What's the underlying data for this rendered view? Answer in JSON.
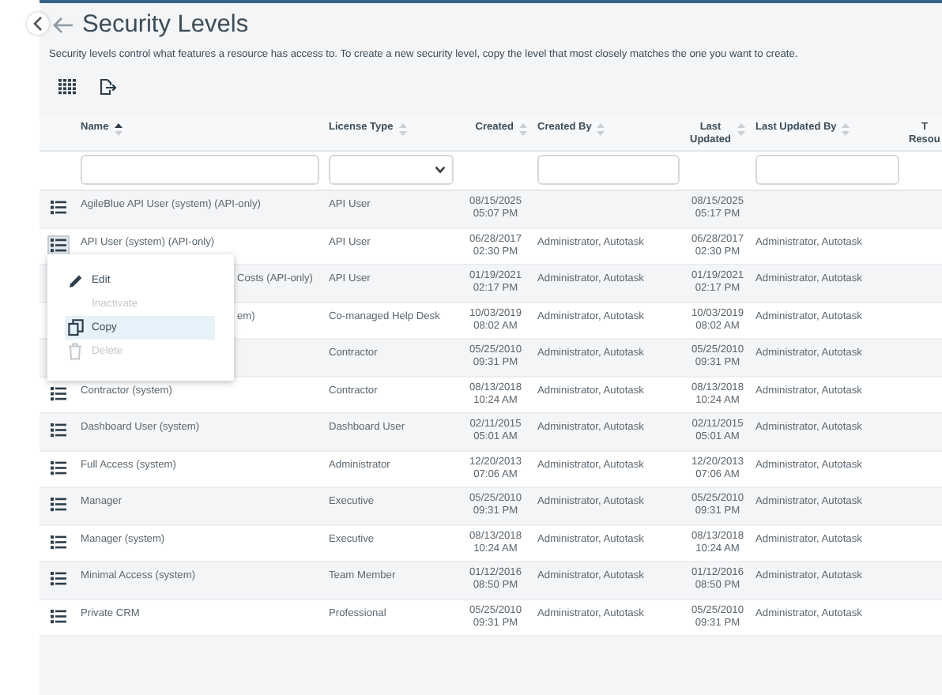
{
  "page": {
    "title": "Security Levels",
    "description": "Security levels control what features a resource has access to. To create a new security level, copy the level that most closely matches the one you want to create."
  },
  "table": {
    "columns": [
      {
        "label": "Name",
        "sorted": true,
        "kind": "text"
      },
      {
        "label": "License Type",
        "sorted": false,
        "kind": "select"
      },
      {
        "label": "Created",
        "sorted": false,
        "kind": "plain"
      },
      {
        "label": "Created By",
        "sorted": false,
        "kind": "text"
      },
      {
        "label": "Last Updated",
        "sorted": false,
        "kind": "plain"
      },
      {
        "label": "Last Updated By",
        "sorted": false,
        "kind": "text"
      },
      {
        "label": "T Resou",
        "kind": "plain"
      }
    ],
    "rows": [
      {
        "name": "AgileBlue API User (system) (API-only)",
        "license_type": "API User",
        "created": "08/15/2025 05:07 PM",
        "last_updated": "08/15/2025 05:17 PM",
        "menu_open": false
      },
      {
        "name": "API User (system) (API-only)",
        "license_type": "API User",
        "created": "06/28/2017 02:30 PM",
        "created_by": "Administrator, Autotask",
        "last_updated": "06/28/2017 02:30 PM",
        "last_updated_by": "Administrator, Autotask",
        "menu_open": true
      },
      {
        "name": "Costs (API-only)",
        "license_type": "API User",
        "created": "01/19/2021 02:17 PM",
        "created_by": "Administrator, Autotask",
        "last_updated": "01/19/2021 02:17 PM",
        "last_updated_by": "Administrator, Autotask",
        "covered": true
      },
      {
        "name": "em)",
        "license_type": "Co-managed Help Desk",
        "created": "10/03/2019 08:02 AM",
        "created_by": "Administrator, Autotask",
        "last_updated": "10/03/2019 08:02 AM",
        "last_updated_by": "Administrator, Autotask",
        "covered": true
      },
      {
        "license_type": "Contractor",
        "created": "05/25/2010 09:31 PM",
        "created_by": "Administrator, Autotask",
        "last_updated": "05/25/2010 09:31 PM",
        "last_updated_by": "Administrator, Autotask"
      },
      {
        "name": "Contractor (system)",
        "license_type": "Contractor",
        "created": "08/13/2018 10:24 AM",
        "created_by": "Administrator, Autotask",
        "last_updated": "08/13/2018 10:24 AM",
        "last_updated_by": "Administrator, Autotask",
        "menu_open": false
      },
      {
        "name": "Dashboard User (system)",
        "license_type": "Dashboard User",
        "created": "02/11/2015 05:01 AM",
        "created_by": "Administrator, Autotask",
        "last_updated": "02/11/2015 05:01 AM",
        "last_updated_by": "Administrator, Autotask",
        "menu_open": false
      },
      {
        "name": "Full Access (system)",
        "license_type": "Administrator",
        "created": "12/20/2013 07:06 AM",
        "created_by": "Administrator, Autotask",
        "last_updated": "12/20/2013 07:06 AM",
        "last_updated_by": "Administrator, Autotask",
        "menu_open": false
      },
      {
        "name": "Manager",
        "license_type": "Executive",
        "created": "05/25/2010 09:31 PM",
        "created_by": "Administrator, Autotask",
        "last_updated": "05/25/2010 09:31 PM",
        "last_updated_by": "Administrator, Autotask",
        "menu_open": false
      },
      {
        "name": "Manager (system)",
        "license_type": "Executive",
        "created": "08/13/2018 10:24 AM",
        "created_by": "Administrator, Autotask",
        "last_updated": "08/13/2018 10:24 AM",
        "last_updated_by": "Administrator, Autotask",
        "menu_open": false
      },
      {
        "name": "Minimal Access (system)",
        "license_type": "Team Member",
        "created": "01/12/2016 08:50 PM",
        "created_by": "Administrator, Autotask",
        "last_updated": "01/12/2016 08:50 PM",
        "last_updated_by": "Administrator, Autotask",
        "menu_open": false
      },
      {
        "name": "Private CRM",
        "license_type": "Professional",
        "created": "05/25/2010 09:31 PM",
        "created_by": "Administrator, Autotask",
        "last_updated": "05/25/2010 09:31 PM",
        "last_updated_by": "Administrator, Autotask",
        "menu_open": false
      }
    ]
  },
  "context_menu": {
    "items": [
      {
        "label": "Edit",
        "disabled": false,
        "selected": false
      },
      {
        "label": "Inactivate",
        "disabled": true,
        "selected": false
      },
      {
        "label": "Copy",
        "disabled": false,
        "selected": true
      },
      {
        "label": "Delete",
        "disabled": true,
        "selected": false
      }
    ]
  }
}
